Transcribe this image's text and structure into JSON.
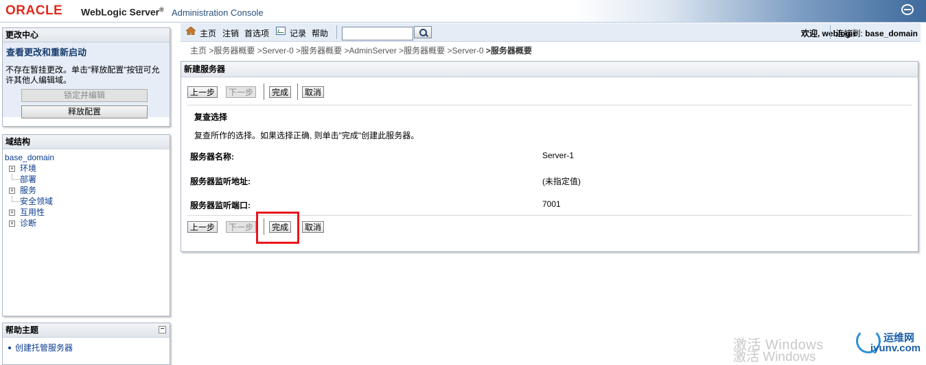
{
  "header": {
    "oracle": "ORACLE",
    "product": "WebLogic Server",
    "reg": "®",
    "console": "Administration Console"
  },
  "change_center": {
    "title": "更改中心",
    "subtitle": "查看更改和重新启动",
    "message": "不存在暂挂更改。单击\"释放配置\"按钮可允许其他人编辑域。",
    "lock_button": "锁定并编辑",
    "release_button": "释放配置"
  },
  "domain_structure": {
    "title": "域结构",
    "root": "base_domain",
    "items": [
      {
        "label": "环境",
        "expandable": true
      },
      {
        "label": "部署",
        "expandable": false
      },
      {
        "label": "服务",
        "expandable": true
      },
      {
        "label": "安全领域",
        "expandable": false
      },
      {
        "label": "互用性",
        "expandable": true
      },
      {
        "label": "诊断",
        "expandable": true
      }
    ]
  },
  "help": {
    "title": "帮助主题",
    "collapse": "−",
    "items": [
      "创建托管服务器"
    ]
  },
  "toolbar": {
    "home": "主页",
    "logout": "注销",
    "preferences": "首选项",
    "record": "记录",
    "help": "帮助",
    "search_value": "",
    "welcome": "欢迎, weblogic",
    "connected_label": "连接到: ",
    "connected_domain": "base_domain"
  },
  "breadcrumb": {
    "items": [
      "主页",
      ">服务器概要",
      ">Server-0",
      ">服务器概要",
      ">AdminServer",
      ">服务器概要",
      ">Server-0"
    ],
    "current": ">服务器概要"
  },
  "content": {
    "title": "新建服务器",
    "buttons": {
      "back": "上一步",
      "next": "下一步",
      "finish": "完成",
      "cancel": "取消"
    },
    "section_title": "复查选择",
    "section_desc": "复查所作的选择。如果选择正确, 则单击\"完成\"创建此服务器。",
    "fields": [
      {
        "label": "服务器名称:",
        "value": "Server-1"
      },
      {
        "label": "服务器监听地址:",
        "value": "(未指定值)"
      },
      {
        "label": "服务器监听端口:",
        "value": "7001"
      }
    ]
  },
  "watermark": {
    "line1": "激活 Windows",
    "line2": "激活 Windows",
    "brand_cn": "运维网",
    "brand_en": "iyunv.com"
  },
  "colors": {
    "highlight": "#e8141b",
    "link": "#0a3d8f",
    "oracle_red": "#e02a1c"
  }
}
